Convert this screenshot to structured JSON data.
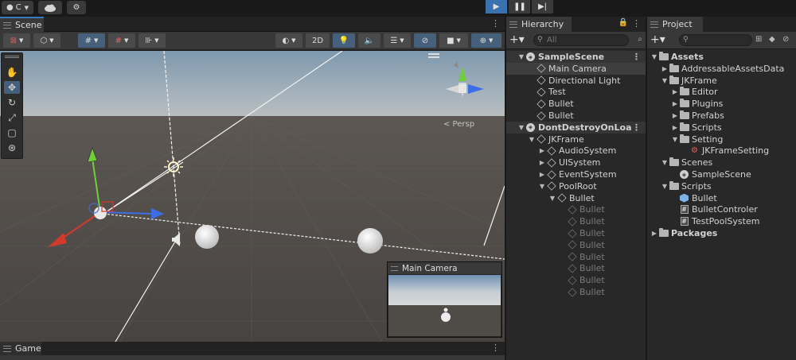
{
  "topbar": {
    "account_label": "C",
    "cloud_icon": "cloud-icon",
    "settings_icon": "gear-icon",
    "play_icon": "play-icon",
    "pause_icon": "pause-icon",
    "step_icon": "step-icon",
    "play_color": "#3a72b0"
  },
  "scene": {
    "tab_label": "Scene",
    "toolbar": {
      "mode_2d": "2D",
      "persp_label": "< Persp"
    },
    "camera_preview_title": "Main Camera"
  },
  "game": {
    "tab_label": "Game"
  },
  "hierarchy": {
    "tab_label": "Hierarchy",
    "search_placeholder": "All",
    "rows": [
      {
        "label": "SampleScene",
        "type": "scene"
      },
      {
        "label": "Main Camera",
        "type": "object"
      },
      {
        "label": "Directional Light",
        "type": "object"
      },
      {
        "label": "Test",
        "type": "object"
      },
      {
        "label": "Bullet",
        "type": "object"
      },
      {
        "label": "Bullet",
        "type": "object"
      },
      {
        "label": "DontDestroyOnLoa",
        "type": "scene"
      },
      {
        "label": "JKFrame",
        "type": "object"
      },
      {
        "label": "AudioSystem",
        "type": "object"
      },
      {
        "label": "UISystem",
        "type": "object"
      },
      {
        "label": "EventSystem",
        "type": "object"
      },
      {
        "label": "PoolRoot",
        "type": "object"
      },
      {
        "label": "Bullet",
        "type": "object"
      },
      {
        "label": "Bullet",
        "type": "inactive"
      },
      {
        "label": "Bullet",
        "type": "inactive"
      },
      {
        "label": "Bullet",
        "type": "inactive"
      },
      {
        "label": "Bullet",
        "type": "inactive"
      },
      {
        "label": "Bullet",
        "type": "inactive"
      },
      {
        "label": "Bullet",
        "type": "inactive"
      },
      {
        "label": "Bullet",
        "type": "inactive"
      },
      {
        "label": "Bullet",
        "type": "inactive"
      }
    ]
  },
  "project": {
    "tab_label": "Project",
    "rows": [
      {
        "label": "Assets",
        "type": "folder-root"
      },
      {
        "label": "AddressableAssetsData",
        "type": "folder"
      },
      {
        "label": "JKFrame",
        "type": "folder"
      },
      {
        "label": "Editor",
        "type": "folder"
      },
      {
        "label": "Plugins",
        "type": "folder"
      },
      {
        "label": "Prefabs",
        "type": "folder"
      },
      {
        "label": "Scripts",
        "type": "folder"
      },
      {
        "label": "Setting",
        "type": "folder"
      },
      {
        "label": "JKFrameSetting",
        "type": "asset"
      },
      {
        "label": "Scenes",
        "type": "folder"
      },
      {
        "label": "SampleScene",
        "type": "scene"
      },
      {
        "label": "Scripts",
        "type": "folder"
      },
      {
        "label": "Bullet",
        "type": "prefab"
      },
      {
        "label": "BulletControler",
        "type": "script"
      },
      {
        "label": "TestPoolSystem",
        "type": "script"
      },
      {
        "label": "Packages",
        "type": "folder-root"
      }
    ]
  },
  "colors": {
    "accent": "#3a79bb",
    "sky": "#8aa3b8",
    "ground": "#4d4944",
    "gizmo_x": "#d23a2e",
    "gizmo_y": "#6fcf3a",
    "gizmo_z": "#3d6ee6"
  }
}
